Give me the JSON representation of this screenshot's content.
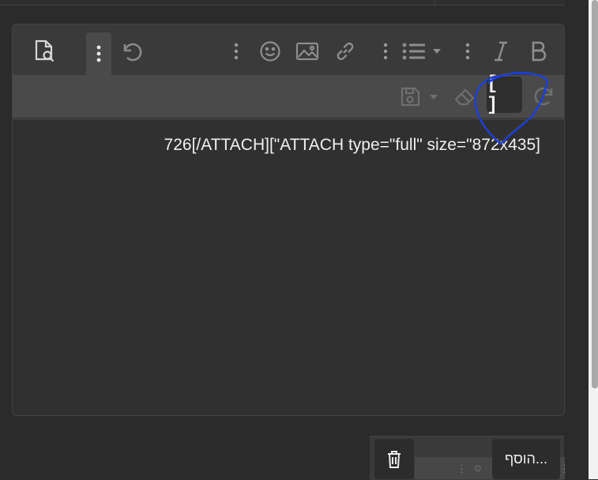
{
  "toolbar": {
    "row1": [
      "preview-icon",
      "more-icon",
      "undo-icon",
      "more-icon",
      "smiley-icon",
      "image-icon",
      "link-icon",
      "more-icon",
      "list-icon",
      "more-icon",
      "italic-icon",
      "bold-icon"
    ],
    "row2": [
      "save-draft-icon",
      "eraser-icon",
      "code-icon",
      "redo-icon"
    ],
    "code_label": "[ ]"
  },
  "editor": {
    "text": "726[/ATTACH][\"ATTACH type=\"full\" size=\"872x435]"
  },
  "actions": {
    "add_label": "הוסף..."
  },
  "colors": {
    "annotation": "#1f3fd1"
  }
}
